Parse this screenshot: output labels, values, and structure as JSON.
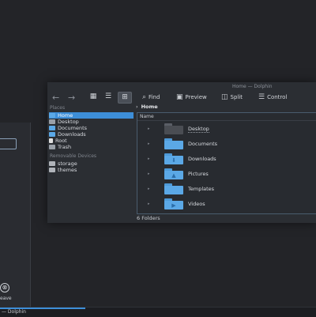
{
  "window": {
    "title": "Home — Dolphin"
  },
  "toolbar": {
    "back_icon": "←",
    "forward_icon": "→",
    "view_icons": [
      "▦",
      "☰",
      "⊞"
    ],
    "find_label": "Find",
    "preview_label": "Preview",
    "split_label": "Split",
    "control_label": "Control",
    "find_icon": "⌕",
    "preview_icon": "▣",
    "split_icon": "◫",
    "control_icon": "☰"
  },
  "places": {
    "title": "Places",
    "items": [
      {
        "label": "Home",
        "icon_color": "#5ba8e6"
      },
      {
        "label": "Desktop",
        "icon_color": "#9aa0a8"
      },
      {
        "label": "Documents",
        "icon_color": "#5ba8e6"
      },
      {
        "label": "Downloads",
        "icon_color": "#5ba8e6"
      },
      {
        "label": "Root",
        "icon_color": "#e0e0e0"
      },
      {
        "label": "Trash",
        "icon_color": "#9aa0a8"
      }
    ]
  },
  "removable": {
    "title": "Removable Devices",
    "items": [
      {
        "label": "storage",
        "icon_color": "#b0b4ba"
      },
      {
        "label": "themes",
        "icon_color": "#b0b4ba"
      }
    ]
  },
  "breadcrumb": {
    "separator": "›",
    "segment": "Home"
  },
  "file_view": {
    "column_header": "Name",
    "folders": [
      {
        "name": "Desktop",
        "glyph": ""
      },
      {
        "name": "Documents",
        "glyph": ""
      },
      {
        "name": "Downloads",
        "glyph": "⬇"
      },
      {
        "name": "Pictures",
        "glyph": "▲"
      },
      {
        "name": "Templates",
        "glyph": ""
      },
      {
        "name": "Videos",
        "glyph": "▶"
      }
    ],
    "expander": "▸"
  },
  "status": {
    "text": "6 Folders"
  },
  "left_panel": {
    "leave_label": "eave",
    "leave_icon": "⊗"
  },
  "taskbar": {
    "label": "— Dolphin"
  },
  "colors": {
    "accent": "#3d8ed8",
    "folder": "#5ba8e6",
    "background": "#232428"
  }
}
